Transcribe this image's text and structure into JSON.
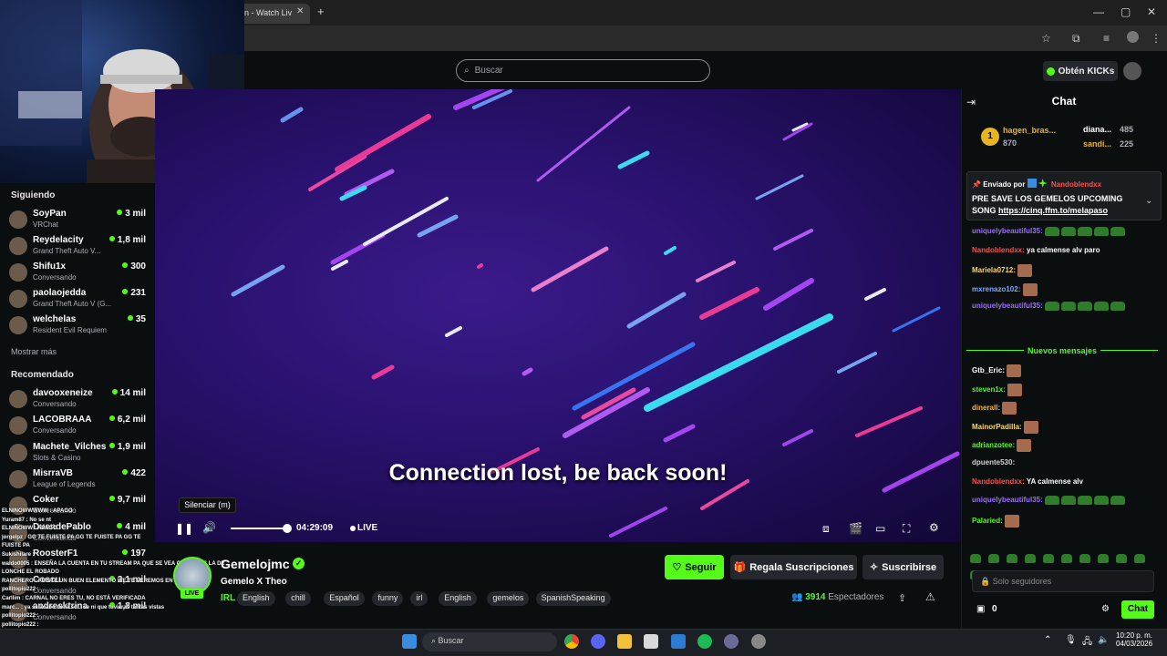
{
  "browser": {
    "tab_title": "n - Watch Liv",
    "close_tab": "✕",
    "new_tab": "+"
  },
  "header": {
    "search_placeholder": "Buscar",
    "kicks_button": "Obtén KICKs"
  },
  "sidebar": {
    "following_title": "Siguiendo",
    "following": [
      {
        "name": "SoyPan",
        "game": "VRChat",
        "viewers": "3 mil"
      },
      {
        "name": "Reydelacity",
        "game": "Grand Theft Auto V...",
        "viewers": "1,8 mil"
      },
      {
        "name": "Shifu1x",
        "game": "Conversando",
        "viewers": "300"
      },
      {
        "name": "paolaojedda",
        "game": "Grand Theft Auto V (G...",
        "viewers": "231"
      },
      {
        "name": "welchelas",
        "game": "Resident Evil Requiem",
        "viewers": "35"
      }
    ],
    "show_more": "Mostrar más",
    "recommended_title": "Recomendado",
    "recommended": [
      {
        "name": "davooxeneize",
        "game": "Conversando",
        "viewers": "14 mil"
      },
      {
        "name": "LACOBRAAA",
        "game": "Conversando",
        "viewers": "6,2 mil"
      },
      {
        "name": "Machete_Vilches",
        "game": "Slots & Casino",
        "viewers": "1,9 mil"
      },
      {
        "name": "MisrraVB",
        "game": "League of Legends",
        "viewers": "422"
      },
      {
        "name": "Coker",
        "game": "Conversando",
        "viewers": "9,7 mil"
      },
      {
        "name": "DuendePablo",
        "game": "Conversando",
        "viewers": "4 mil"
      },
      {
        "name": "RoosterF1",
        "game": "",
        "viewers": "197"
      },
      {
        "name": "Coscu",
        "game": "Conversando",
        "viewers": "2,1 mil"
      },
      {
        "name": "andresktrina",
        "game": "Conversando",
        "viewers": "1,8 mil"
      }
    ]
  },
  "overlay_chat": [
    "ELNINOWWWWW : APAGO",
    "Yuram87 : No se nt",
    "ELNIÑOWW : APAGO",
    "jorgelpz : GG TE FUISTE PA   GG TE FUISTE PA   GG TE",
    "FUISTE PA",
    "Sukishilare :",
    "waldo0005 : ENSEÑA LA CUENTA EN TU STREAM PA QUE SE VEA QUE NO ES LA DE",
    "LONCHE EL ROBADO",
    "RANCHERO : FUISTE UN BUEN ELEMENTO WE TE VEREMOS EN",
    "pollitopio222 :",
    "Carllim : CARNAL NO ERES TU, NO ESTÁ VERIFICADA",
    "marc... : ya se acabo de la sd... se ni que tuvieras tantas vistas",
    "pollitopio222 :",
    "pollitopio222 :"
  ],
  "player": {
    "message": "Connection lost, be back soon!",
    "tooltip": "Silenciar (m)",
    "time": "04:29:09",
    "live_label": "LIVE",
    "volume_level": 1.0
  },
  "channel": {
    "name": "Gemelojmc",
    "live_badge": "LIVE",
    "title": "Gemelo X Theo",
    "category": "IRL",
    "tags": [
      "English",
      "chill",
      "Español",
      "funny",
      "irl",
      "English",
      "gemelos",
      "SpanishSpeaking"
    ],
    "follow_label": "Seguir",
    "gift_label": "Regala Suscripciones",
    "subscribe_label": "Suscribirse",
    "viewers_count": "3914",
    "viewers_label": "Espectadores"
  },
  "chat": {
    "title": "Chat",
    "leaderboard": [
      {
        "rank": "1",
        "name": "hagen_bras...",
        "value": "870"
      },
      {
        "name": "diana...",
        "value": "485"
      },
      {
        "name": "sandi...",
        "value": "225"
      }
    ],
    "pinned_by": "Enviado por",
    "pinned_user": "Nandoblendxx",
    "pinned_text": "PRE SAVE LOS GEMELOS UPCOMING SONG",
    "pinned_link": "https://cinq.ffm.to/melapaso",
    "messages": [
      {
        "user": "uniquelybeautiful35:",
        "text": "",
        "color": "#9a6cff"
      },
      {
        "user": "Nandoblendxx:",
        "text": "ya calmense alv paro",
        "color": "#ff4d4d"
      },
      {
        "user": "Mariela0712:",
        "text": "",
        "color": "#ffd966"
      },
      {
        "user": "mxrenazo102:",
        "text": "",
        "color": "#7fa8ff"
      },
      {
        "user": "uniquelybeautiful35:",
        "text": "",
        "color": "#9a6cff"
      }
    ],
    "new_messages": "Nuevos mensajes",
    "messages2": [
      {
        "user": "Gtb_Eric:",
        "text": "",
        "color": "#ffffff"
      },
      {
        "user": "steven1x:",
        "text": "",
        "color": "#53fc18"
      },
      {
        "user": "dinerall:",
        "text": "",
        "color": "#ffb347"
      },
      {
        "user": "MainorPadilla:",
        "text": "",
        "color": "#ffd966"
      },
      {
        "user": "adrianzotee:",
        "text": "",
        "color": "#53fc18"
      },
      {
        "user": "dpuente530:",
        "text": "",
        "color": "#cfcfcf"
      },
      {
        "user": "Nandoblendxx:",
        "text": "YA calmense alv",
        "color": "#ff4d4d"
      },
      {
        "user": "uniquelybeautiful35:",
        "text": "",
        "color": "#9a6cff"
      },
      {
        "user": "Palaried:",
        "text": "",
        "color": "#53fc18"
      }
    ],
    "input_placeholder": "Solo seguidores",
    "points": "0",
    "send_label": "Chat"
  },
  "taskbar": {
    "search_placeholder": "Buscar",
    "time": "10:20 p. m.",
    "date": "04/03/2026"
  },
  "colors": {
    "accent": "#53fc18",
    "bg": "#0b0e0f"
  }
}
